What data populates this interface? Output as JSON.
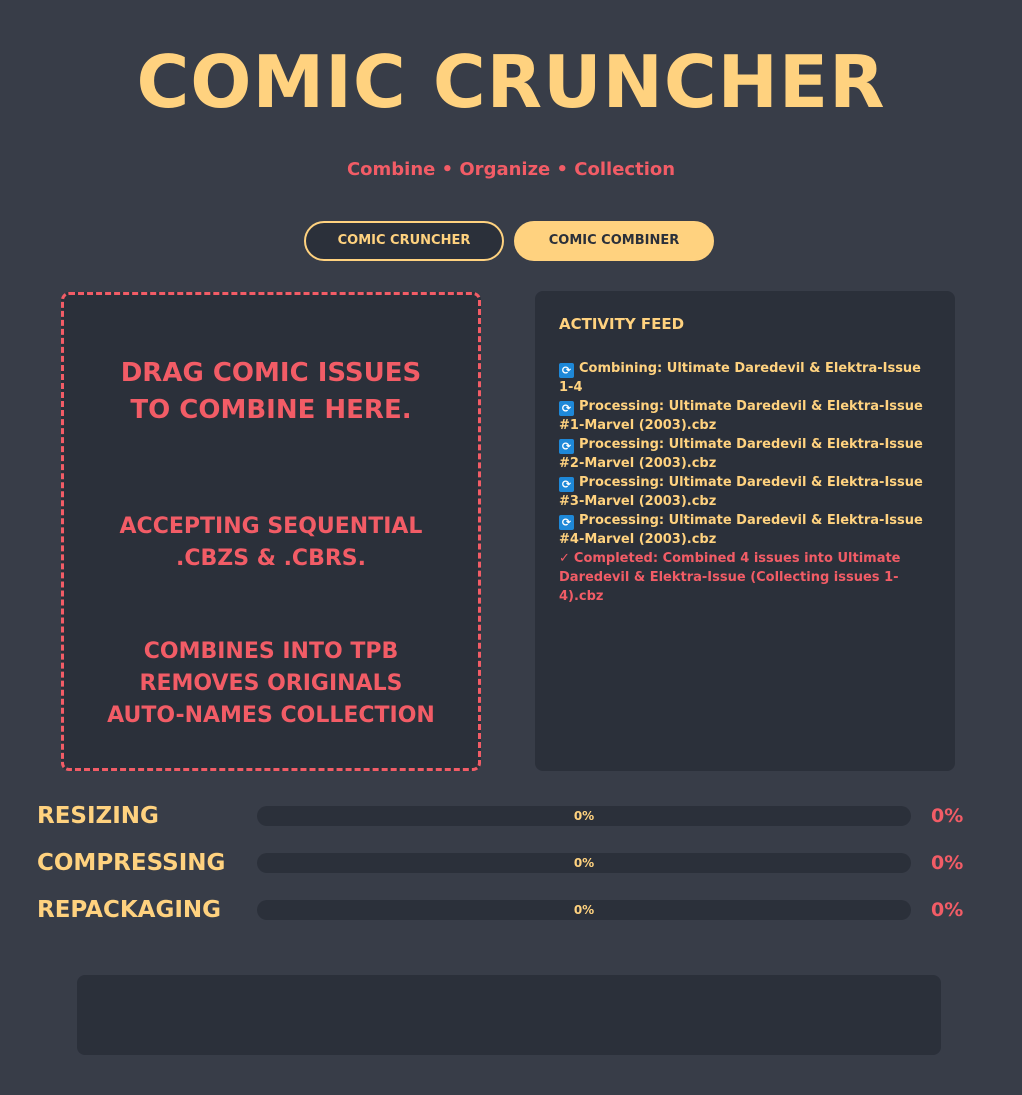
{
  "header": {
    "title": "COMIC CRUNCHER",
    "subtitle": "Combine • Organize • Collection"
  },
  "tabs": [
    {
      "label": "COMIC CRUNCHER",
      "active": false
    },
    {
      "label": "COMIC COMBINER",
      "active": true
    }
  ],
  "dropzone": {
    "drag_lines": [
      "DRAG COMIC ISSUES",
      "TO COMBINE HERE."
    ],
    "accept_lines": [
      "ACCEPTING SEQUENTIAL",
      ".CBZS & .CBRS."
    ],
    "feature_lines": [
      "COMBINES INTO TPB",
      "REMOVES ORIGINALS",
      "AUTO-NAMES COLLECTION"
    ]
  },
  "activity_feed": {
    "title": "ACTIVITY FEED",
    "entries": [
      {
        "icon": "refresh-icon",
        "text": "Combining: Ultimate Daredevil & Elektra-Issue 1-4"
      },
      {
        "icon": "refresh-icon",
        "text": "Processing: Ultimate Daredevil & Elektra-Issue #1-Marvel (2003).cbz"
      },
      {
        "icon": "refresh-icon",
        "text": "Processing: Ultimate Daredevil & Elektra-Issue #2-Marvel (2003).cbz"
      },
      {
        "icon": "refresh-icon",
        "text": "Processing: Ultimate Daredevil & Elektra-Issue #3-Marvel (2003).cbz"
      },
      {
        "icon": "refresh-icon",
        "text": "Processing: Ultimate Daredevil & Elektra-Issue #4-Marvel (2003).cbz"
      },
      {
        "icon": "check-icon",
        "text": "Completed: Combined 4 issues into Ultimate Daredevil & Elektra-Issue (Collecting issues 1-4).cbz"
      }
    ]
  },
  "progress": [
    {
      "label": "RESIZING",
      "value": 0,
      "bar_text": "0%",
      "percent_text": "0%"
    },
    {
      "label": "COMPRESSING",
      "value": 0,
      "bar_text": "0%",
      "percent_text": "0%"
    },
    {
      "label": "REPACKAGING",
      "value": 0,
      "bar_text": "0%",
      "percent_text": "0%"
    }
  ],
  "colors": {
    "background": "#383d48",
    "panel": "#2b303a",
    "accent_yellow": "#ffd27f",
    "accent_red": "#f25c66",
    "icon_blue": "#1e88d8"
  }
}
